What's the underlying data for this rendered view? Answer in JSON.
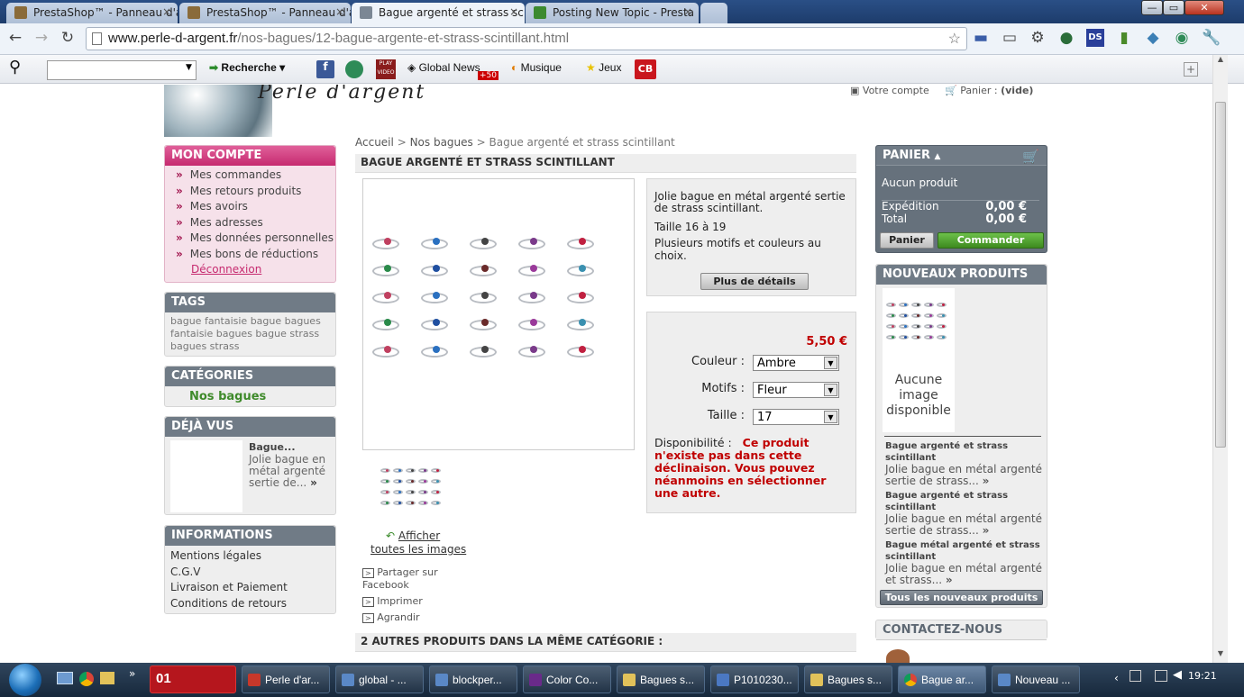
{
  "browser": {
    "tabs": [
      {
        "label": "PrestaShop™ - Panneau d'a",
        "color": "#8a6b3a"
      },
      {
        "label": "PrestaShop™ - Panneau d'a",
        "color": "#8a6b3a"
      },
      {
        "label": "Bague argenté et strass scii",
        "color": "#7b8794"
      },
      {
        "label": "Posting New Topic - Presta",
        "color": "#3c8a2f"
      }
    ],
    "url_host": "www.perle-d-argent.fr",
    "url_path": "/nos-bagues/12-bague-argente-et-strass-scintillant.html",
    "toolbar2": {
      "search_placeholder": "",
      "recherche": "Recherche",
      "global_news": "Global News",
      "news_badge": "+50",
      "musique": "Musique",
      "jeux": "Jeux",
      "cb": "CB",
      "play_video": "PLAY VIDEO"
    }
  },
  "site": {
    "logo": "Perle d'argent",
    "header_links": {
      "account": "Votre compte",
      "cart_label": "Panier :",
      "cart_value": "(vide)"
    }
  },
  "left": {
    "mon_compte": {
      "title": "MON COMPTE",
      "items": [
        "Mes commandes",
        "Mes retours produits",
        "Mes avoirs",
        "Mes adresses",
        "Mes données personnelles",
        "Mes bons de réductions"
      ],
      "logout": "Déconnexion"
    },
    "tags": {
      "title": "TAGS",
      "text": "bague fantaisie bague bagues fantaisie bagues bague strass bagues strass"
    },
    "categories": {
      "title": "CATÉGORIES",
      "item": "Nos bagues"
    },
    "deja_vus": {
      "title": "DÉJÀ VUS",
      "name": "Bague...",
      "desc": "Jolie bague en métal argenté sertie de..."
    },
    "informations": {
      "title": "INFORMATIONS",
      "items": [
        "Mentions légales",
        "C.G.V",
        "Livraison et Paiement",
        "Conditions de retours"
      ]
    }
  },
  "center": {
    "breadcrumb": [
      "Accueil",
      ">",
      "Nos bagues",
      ">",
      "Bague argenté et strass scintillant"
    ],
    "product_title": "BAGUE ARGENTÉ ET STRASS SCINTILLANT",
    "short_desc_1": "Jolie bague en métal argenté sertie de strass scintillant.",
    "short_desc_2": "Taille 16 à 19",
    "short_desc_3": "Plusieurs motifs et couleurs au choix.",
    "more_details": "Plus de détails",
    "price": "5,50 €",
    "attributes": [
      {
        "label": "Couleur :",
        "value": "Ambre"
      },
      {
        "label": "Motifs :",
        "value": "Fleur"
      },
      {
        "label": "Taille :",
        "value": "17"
      }
    ],
    "availability_label": "Disponibilité :",
    "availability_text": "Ce produit n'existe pas dans cette déclinaison. Vous pouvez néanmoins en sélectionner une autre.",
    "show_all_images_1": "Afficher",
    "show_all_images_2": "toutes les images",
    "share_facebook_1": "Partager sur",
    "share_facebook_2": "Facebook",
    "print": "Imprimer",
    "enlarge": "Agrandir",
    "others_title": "2 AUTRES PRODUITS DANS LA MÊME CATÉGORIE :"
  },
  "right": {
    "panier": {
      "title": "PANIER",
      "empty": "Aucun produit",
      "expedition_label": "Expédition",
      "expedition_value": "0,00 €",
      "total_label": "Total",
      "total_value": "0,00 €",
      "btn_panier": "Panier",
      "btn_commander": "Commander"
    },
    "nouveaux": {
      "title": "NOUVEAUX PRODUITS",
      "no_image": "Aucune image disponible",
      "items": [
        {
          "name": "Bague argenté et strass scintillant",
          "desc": "Jolie bague en métal argenté sertie de strass..."
        },
        {
          "name": "Bague argenté et strass scintillant",
          "desc": "Jolie bague en métal argenté sertie de strass..."
        },
        {
          "name": "Bague métal argenté et strass scintillant",
          "desc": "Jolie bague en métal argenté et strass..."
        }
      ],
      "all_button": "Tous les nouveaux produits"
    },
    "contact": {
      "title": "CONTACTEZ-NOUS"
    }
  },
  "taskbar": {
    "items": [
      {
        "label": "",
        "color": "#cc1f1f"
      },
      {
        "label": "Perle d'ar...",
        "color": "#c7382a"
      },
      {
        "label": "global - ...",
        "color": "#5a88c6"
      },
      {
        "label": "blockper...",
        "color": "#5a88c6"
      },
      {
        "label": "Color Co...",
        "color": "#6a2a8a"
      },
      {
        "label": "Bagues s...",
        "color": "#e2c25a"
      },
      {
        "label": "P1010230...",
        "color": "#4b78c2"
      },
      {
        "label": "Bagues s...",
        "color": "#e2c25a"
      },
      {
        "label": "Bague ar...",
        "color": "#e05a2a"
      },
      {
        "label": "Nouveau ...",
        "color": "#5a88c6"
      }
    ],
    "quick_badge": "01",
    "clock": "19:21"
  },
  "colors": {
    "pink_header": "#d43b7d",
    "pink_bg": "#f6e1ea",
    "price_red": "#c00000",
    "green": "#4d9a2a"
  }
}
